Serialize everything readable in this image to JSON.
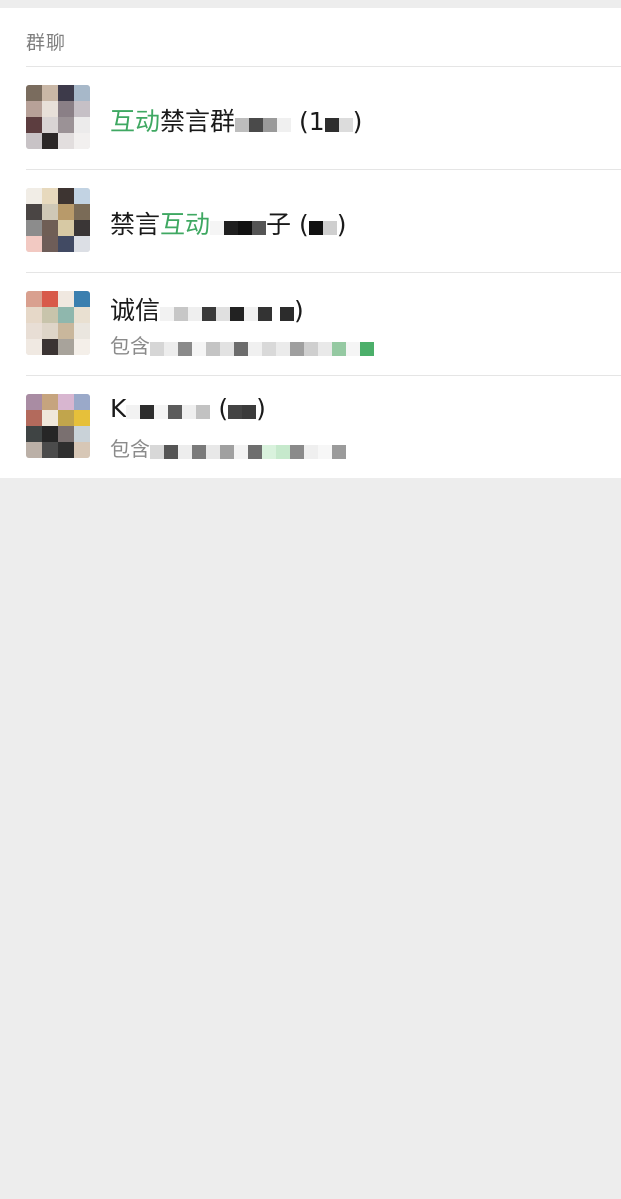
{
  "section": {
    "title": "群聊"
  },
  "groups": [
    {
      "name_highlight": "互动",
      "name_rest": "禁言群",
      "name_tail": "(1",
      "member_count": "",
      "subtitle": ""
    },
    {
      "name_prefix": "禁言",
      "name_highlight": "互动",
      "name_rest": "子",
      "name_tail": "(",
      "member_count": ")",
      "subtitle": ""
    },
    {
      "name_prefix": "诚信",
      "name_tail": ")",
      "subtitle": "包含"
    },
    {
      "name_prefix": "K",
      "name_tail": "(",
      "member_count": ")",
      "subtitle": "包含"
    }
  ],
  "colors": {
    "highlight": "#3fa862",
    "background": "#ededed",
    "panel": "#ffffff",
    "divider": "#e5e5e5"
  }
}
